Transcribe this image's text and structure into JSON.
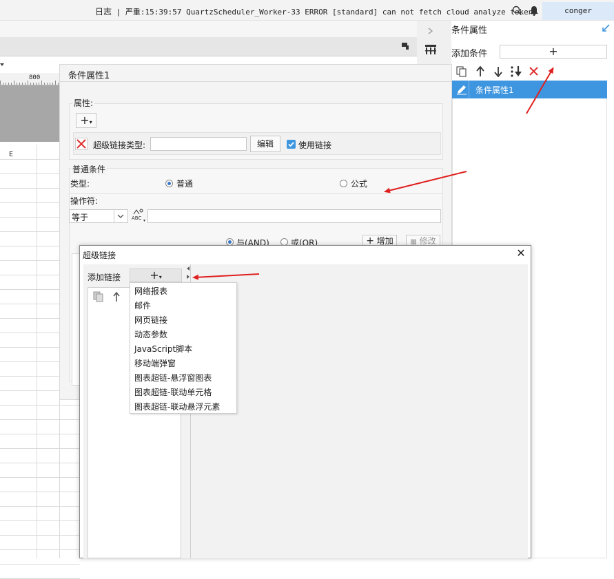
{
  "topbar": {
    "log_label": "日志",
    "log_message": "| 严重:15:39:57 QuartzScheduler_Worker-33 ERROR [standard] can not fetch cloud analyze token.",
    "user": "conger"
  },
  "sheet": {
    "ruler_label": "800",
    "column_label": "E"
  },
  "right_panel": {
    "title": "条件属性",
    "add_condition_label": "添加条件",
    "add_symbol": "+",
    "items": [
      {
        "label": "条件属性1"
      }
    ]
  },
  "condition": {
    "title": "条件属性1",
    "property_section": "属性:",
    "hyperlink_type_label": "超级链接类型:",
    "hyperlink_type_value": "",
    "edit_button": "编辑",
    "use_link_label": "使用链接",
    "use_link_checked": true,
    "normal_condition_section": "普通条件",
    "type_label": "类型:",
    "type_options": [
      "普通",
      "公式"
    ],
    "type_selected": "普通",
    "operator_label": "操作符:",
    "operator_value": "等于",
    "operand_value": "",
    "logic_options": [
      "与(AND)",
      "或(OR)"
    ],
    "add_button": "增加",
    "modify_button": "修改"
  },
  "dialog": {
    "title": "超级链接",
    "add_link_label": "添加链接",
    "menu_items": [
      "网络报表",
      "邮件",
      "网页链接",
      "动态参数",
      "JavaScript脚本",
      "移动端弹窗",
      "图表超链-悬浮窗图表",
      "图表超链-联动单元格",
      "图表超链-联动悬浮元素"
    ]
  },
  "colors": {
    "accent": "#3f96e0",
    "annotation_arrow": "#e02020"
  }
}
